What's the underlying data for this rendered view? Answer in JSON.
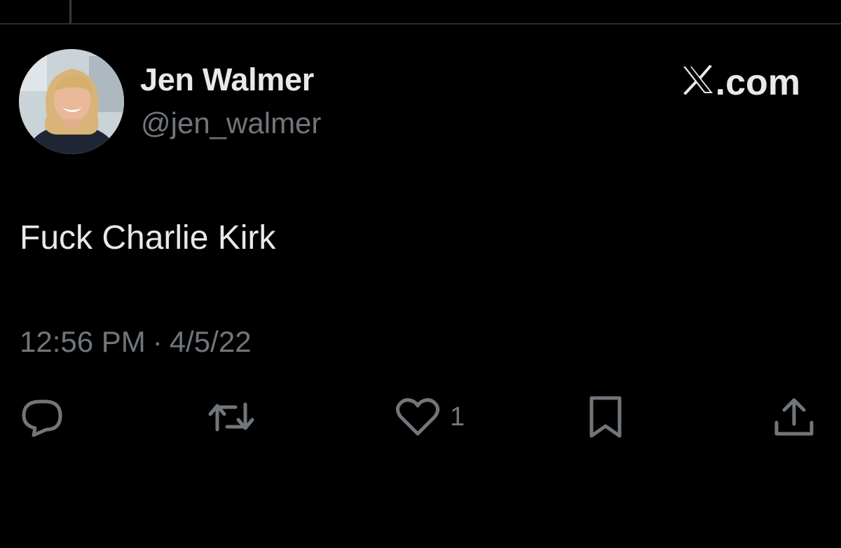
{
  "author": {
    "display_name": "Jen Walmer",
    "handle": "@jen_walmer",
    "avatar_icon": "profile-photo"
  },
  "brand": {
    "label": ".com",
    "mark_icon": "x-logo-icon"
  },
  "tweet": {
    "text": "Fuck Charlie Kirk",
    "time": "12:56 PM",
    "separator": "·",
    "date": "4/5/22"
  },
  "actions": {
    "reply_icon": "reply-icon",
    "retweet_icon": "retweet-icon",
    "like_icon": "heart-icon",
    "like_count": "1",
    "bookmark_icon": "bookmark-icon",
    "share_icon": "share-icon"
  },
  "colors": {
    "background": "#000000",
    "primary_text": "#e7e9ea",
    "secondary_text": "#71767b"
  }
}
